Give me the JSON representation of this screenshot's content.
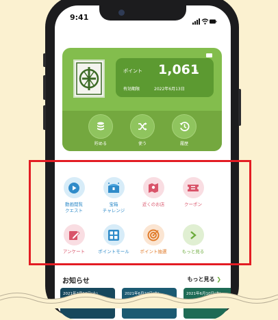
{
  "status_bar": {
    "time": "9:41"
  },
  "points_card": {
    "points_label": "ポイント",
    "points_value": "1,061",
    "points_unit": "p",
    "expiry_label": "有効期限",
    "expiry_date": "2022年6月13日",
    "actions": [
      {
        "label": "貯める",
        "icon": "coins-icon"
      },
      {
        "label": "使う",
        "icon": "shuffle-icon"
      },
      {
        "label": "履歴",
        "icon": "history-icon"
      }
    ]
  },
  "menu_grid": [
    {
      "label": "動画閲覧\nクエスト",
      "icon": "play-icon",
      "color": "#2f8bc9",
      "bg": "#d7ecf8"
    },
    {
      "label": "宝箱\nチャレンジ",
      "icon": "treasure-icon",
      "color": "#2f8bc9",
      "bg": "#d7ecf8"
    },
    {
      "label": "近くのお店",
      "icon": "map-pin-icon",
      "color": "#d9546a",
      "bg": "#f9dde2"
    },
    {
      "label": "クーポン",
      "icon": "ticket-icon",
      "color": "#d9546a",
      "bg": "#f9dde2"
    },
    {
      "label": "アンケート",
      "icon": "pencil-icon",
      "color": "#d9546a",
      "bg": "#f9dde2"
    },
    {
      "label": "ポイントモール",
      "icon": "grid-icon",
      "color": "#2f8bc9",
      "bg": "#d7ecf8"
    },
    {
      "label": "ポイント抽選",
      "icon": "target-icon",
      "color": "#e07b2b",
      "bg": "#fbe5d2"
    },
    {
      "label": "もっと見る",
      "icon": "chevron-right-icon",
      "color": "#6cab3c",
      "bg": "#e0efd2"
    }
  ],
  "news": {
    "title": "お知らせ",
    "more_label": "もっと見る",
    "cards": [
      {
        "date": "2021年7月10日(土)"
      },
      {
        "date": "2021年6月24日(木)"
      },
      {
        "date": "2021年6月10日(木)"
      }
    ]
  },
  "colors": {
    "highlight": "#e31c23",
    "card_green": "#83bd4d",
    "background": "#fbf1d0"
  }
}
